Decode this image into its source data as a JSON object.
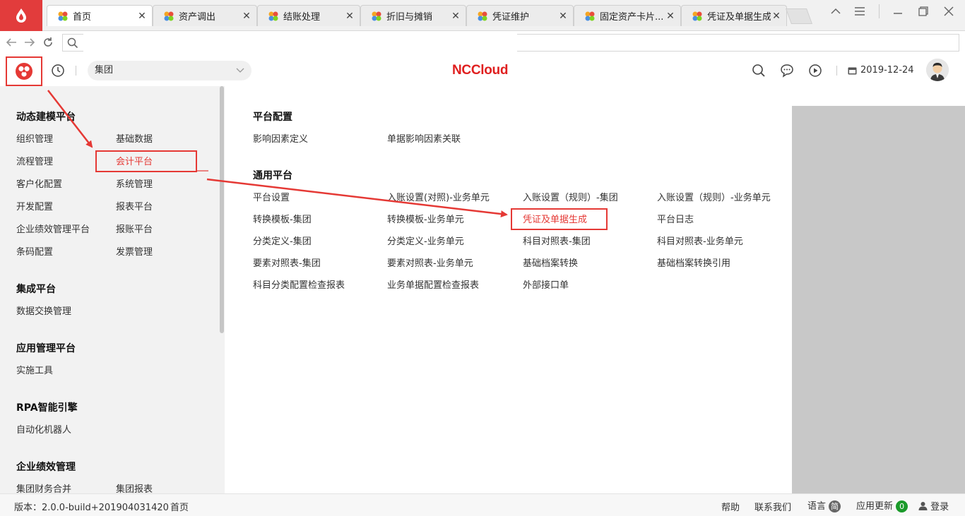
{
  "browser": {
    "tabs": [
      {
        "title": "首页",
        "active": true
      },
      {
        "title": "资产调出",
        "active": false
      },
      {
        "title": "结账处理",
        "active": false
      },
      {
        "title": "折旧与摊销",
        "active": false
      },
      {
        "title": "凭证维护",
        "active": false
      },
      {
        "title": "固定资产卡片...",
        "active": false
      },
      {
        "title": "凭证及单据生成",
        "active": false
      }
    ]
  },
  "header": {
    "org_select_value": "集团",
    "brand": "NCCloud",
    "date": "2019-12-24"
  },
  "left_menu": {
    "groups": [
      {
        "title": "动态建模平台",
        "items": [
          "组织管理",
          "基础数据",
          "流程管理",
          "会计平台",
          "客户化配置",
          "系统管理",
          "开发配置",
          "报表平台",
          "企业绩效管理平台",
          "报账平台",
          "条码配置",
          "发票管理"
        ]
      },
      {
        "title": "集成平台",
        "items": [
          "数据交换管理"
        ]
      },
      {
        "title": "应用管理平台",
        "items": [
          "实施工具"
        ]
      },
      {
        "title": "RPA智能引擎",
        "items": [
          "自动化机器人"
        ]
      },
      {
        "title": "企业绩效管理",
        "items": [
          "集团财务合并",
          "集团报表"
        ]
      }
    ],
    "highlighted": "会计平台"
  },
  "right_panel": {
    "sections": [
      {
        "title": "平台配置",
        "items": [
          "影响因素定义",
          "单据影响因素关联"
        ]
      },
      {
        "title": "通用平台",
        "items": [
          "平台设置",
          "入账设置(对照)-业务单元",
          "入账设置（规则）-集团",
          "入账设置（规则）-业务单元",
          "转换模板-集团",
          "转换模板-业务单元",
          "凭证及单据生成",
          "平台日志",
          "分类定义-集团",
          "分类定义-业务单元",
          "科目对照表-集团",
          "科目对照表-业务单元",
          "要素对照表-集团",
          "要素对照表-业务单元",
          "基础档案转换",
          "基础档案转换引用",
          "科目分类配置检查报表",
          "业务单据配置检查报表",
          "外部接口单"
        ]
      }
    ],
    "highlighted": "凭证及单据生成"
  },
  "footer": {
    "version": "版本：2.0.0-build+201904031420",
    "home": "首页",
    "help": "帮助",
    "contact": "联系我们",
    "language": "语言",
    "language_badge": "简",
    "update": "应用更新",
    "update_count": "0",
    "login": "登录"
  },
  "colors": {
    "accent": "#e53935",
    "brand": "#e02020",
    "badge_green": "#1a9a2a",
    "badge_gray": "#666666"
  }
}
